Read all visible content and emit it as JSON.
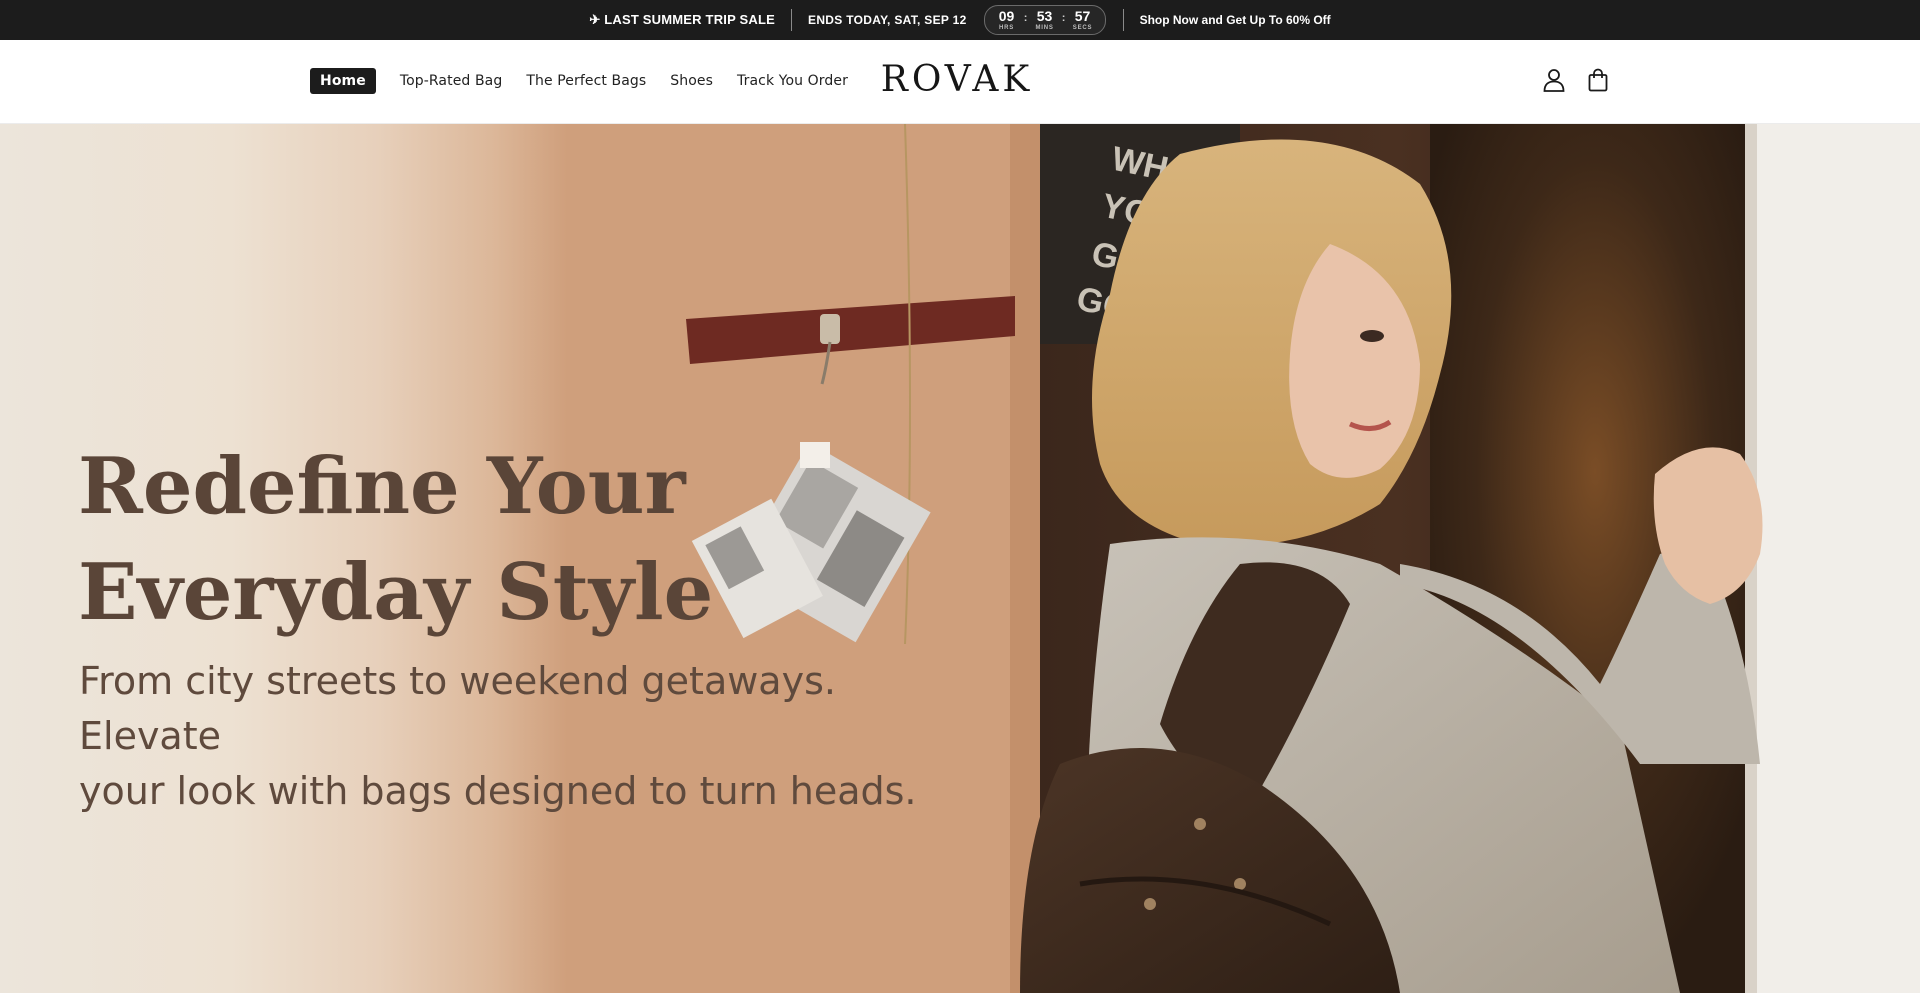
{
  "announcement": {
    "sale_text": "✈ LAST SUMMER TRIP SALE",
    "ends_text": "ENDS TODAY, SAT, SEP 12",
    "countdown": [
      {
        "value": "09",
        "label": "HRS"
      },
      {
        "value": "53",
        "label": "MINS"
      },
      {
        "value": "57",
        "label": "SECS"
      }
    ],
    "separator": ":",
    "promo_text": "Shop Now and Get Up To 60% Off"
  },
  "header": {
    "nav": [
      {
        "label": "Home",
        "active": true
      },
      {
        "label": "Top-Rated Bag",
        "active": false
      },
      {
        "label": "The Perfect Bags",
        "active": false
      },
      {
        "label": "Shoes",
        "active": false
      },
      {
        "label": "Track You Order",
        "active": false
      }
    ],
    "logo": "ROVAK",
    "icons": [
      "account-icon",
      "cart-icon"
    ]
  },
  "hero": {
    "title_line1": "Redefine Your",
    "title_line2": "Everyday Style",
    "subtitle_line1": "From city streets to weekend getaways. Elevate",
    "subtitle_line2": "your look with bags designed to turn heads.",
    "poster_text": [
      "WHAT",
      "YOU'RE",
      "GONN",
      "GONN"
    ]
  },
  "colors": {
    "announcement_bg": "#1c1c1c",
    "nav_active_bg": "#1c1c1c",
    "hero_title": "#5a4538",
    "hero_subtitle": "#5f4a3d"
  }
}
